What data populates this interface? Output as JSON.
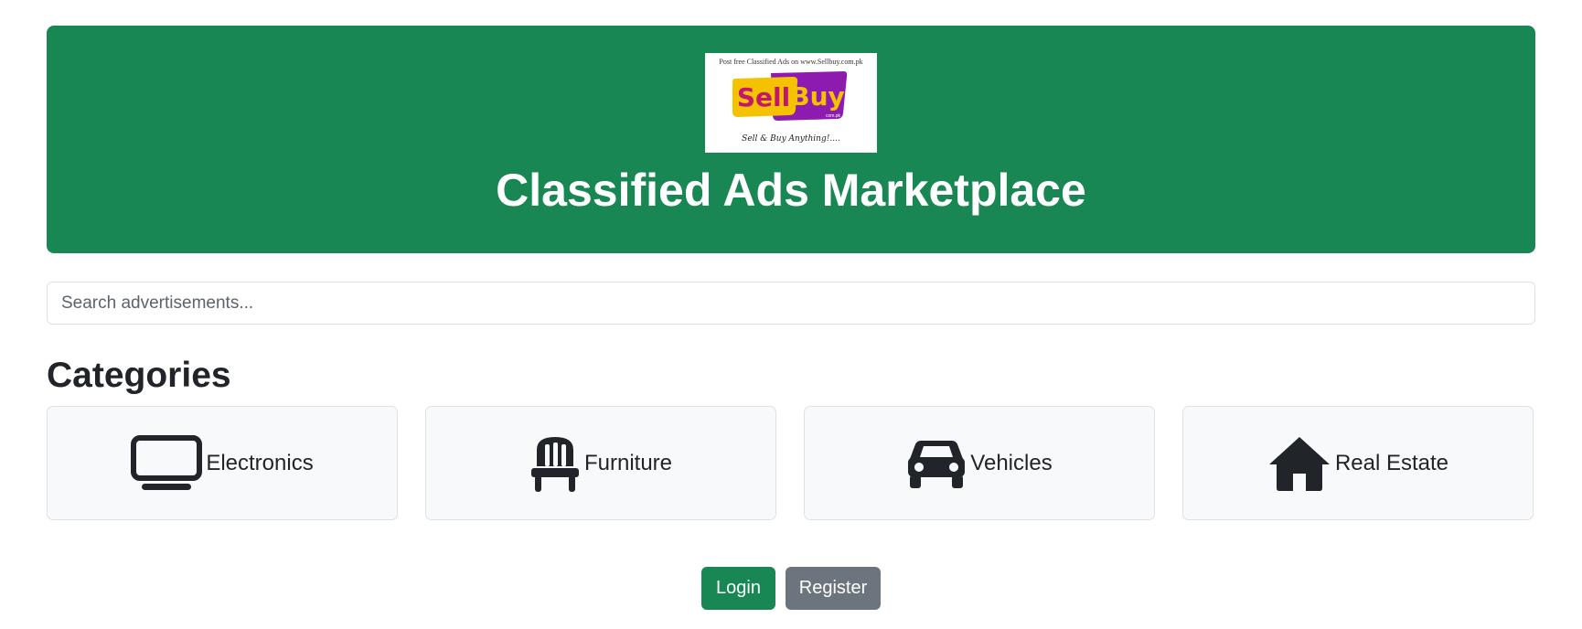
{
  "logo": {
    "tagline_top": "Post free Classified Ads on www.Sellbuy.com.pk",
    "word_sell": "Sell",
    "word_buy": "Buy",
    "domain_small": "com.pk",
    "tagline_bottom": "Sell & Buy Anything!....",
    "colors": {
      "yellow": "#f5c200",
      "purple": "#8e1bb0",
      "pink": "#c2186b"
    }
  },
  "hero": {
    "title": "Classified Ads Marketplace",
    "bg_color": "#198754"
  },
  "search": {
    "placeholder": "Search advertisements..."
  },
  "categories": {
    "heading": "Categories",
    "items": [
      {
        "label": "Electronics",
        "icon": "tv-icon"
      },
      {
        "label": "Furniture",
        "icon": "chair-icon"
      },
      {
        "label": "Vehicles",
        "icon": "car-icon"
      },
      {
        "label": "Real Estate",
        "icon": "house-icon"
      }
    ]
  },
  "auth": {
    "login_label": "Login",
    "register_label": "Register",
    "login_color": "#198754",
    "register_color": "#6c757d"
  }
}
